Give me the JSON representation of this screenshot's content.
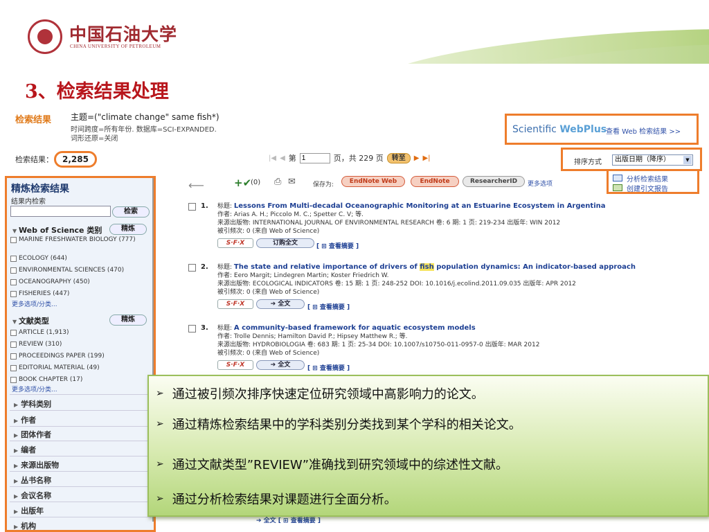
{
  "header": {
    "logo_cn": "中国石油大学",
    "logo_en": "CHINA UNIVERSITY OF PETROLEUM"
  },
  "slide_title": "3、检索结果处理",
  "search": {
    "result_heading": "检索结果",
    "query": "主题=(\"climate change\" same fish*)",
    "timespan": "时间跨度=所有年份. 数据库=SCI-EXPANDED.",
    "lemmatization": "词形还原=关闭",
    "count_label": "检索结果：",
    "count_value": "2,285"
  },
  "scientific_webplus": {
    "logo_a": "Scientific ",
    "logo_b": "WebPlus",
    "link": "查看 Web 检索结果 >>"
  },
  "pager": {
    "first": "|◀",
    "prev": "◀",
    "page_label": "第",
    "page_value": "1",
    "total": "页，共 229 页",
    "goto": "转至",
    "next": "▶",
    "last": "▶|"
  },
  "sort": {
    "label": "排序方式",
    "value": "出版日期（降序）"
  },
  "refine": {
    "title": "精炼检索结果",
    "within_label": "结果内检索",
    "search_btn": "检索",
    "wos_section": "Web of Science 类别",
    "refine_btn": "精炼",
    "wos_items": [
      "MARINE FRESHWATER BIOLOGY (777)",
      "ECOLOGY (644)",
      "ENVIRONMENTAL SCIENCES (470)",
      "OCEANOGRAPHY (450)",
      "FISHERIES (447)"
    ],
    "more": "更多选项/分类...",
    "doc_section": "文献类型",
    "doc_items": [
      "ARTICLE (1,913)",
      "REVIEW (310)",
      "PROCEEDINGS PAPER (199)",
      "EDITORIAL MATERIAL (49)",
      "BOOK CHAPTER (17)"
    ],
    "categories": [
      "学科类别",
      "作者",
      "团体作者",
      "编者",
      "来源出版物",
      "丛书名称",
      "会议名称",
      "出版年",
      "机构"
    ]
  },
  "toolbar": {
    "count": "(0)",
    "save_as": "保存为:",
    "endnote_web": "EndNote Web",
    "endnote": "EndNote",
    "researcherid": "ResearcherID",
    "more": "更多选项",
    "analyze": "分析检索结果",
    "citation_report": "创建引文报告"
  },
  "records": [
    {
      "num": "1.",
      "title_prefix": "标题: ",
      "title": "Lessons From Multi-decadal Oceanographic Monitoring at an Estuarine Ecosystem in Argentina",
      "authors": "作者: Arias A. H.; Piccolo M. C.; Spetter C. V; 等.",
      "source": "来源出版物: INTERNATIONAL JOURNAL OF ENVIRONMENTAL RESEARCH  卷: 6  期: 1  页: 219-234  出版年: WIN 2012",
      "cited": "被引频次: 0 (来自 Web of Science)",
      "fulltext": "订购全文",
      "abstract": "[ ⊞ 查看摘要 ]"
    },
    {
      "num": "2.",
      "title_prefix": "标题: ",
      "title_a": "The state and relative importance of drivers of ",
      "title_hl": "fish",
      "title_b": " population dynamics: An indicator-based approach",
      "authors": "作者: Eero Margit; Lindegren Martin; Koster Friedrich W.",
      "source": "来源出版物: ECOLOGICAL INDICATORS  卷: 15  期: 1  页: 248-252  DOI: 10.1016/j.ecolind.2011.09.035  出版年: APR 2012",
      "cited": "被引频次: 0 (来自 Web of Science)",
      "fulltext": "➔ 全文",
      "abstract": "[ ⊞ 查看摘要 ]"
    },
    {
      "num": "3.",
      "title_prefix": "标题: ",
      "title": "A community-based framework for aquatic ecosystem models",
      "authors": "作者: Trolle Dennis; Hamilton David P.; Hipsey Matthew R.; 等.",
      "source": "来源出版物: HYDROBIOLOGIA  卷: 683  期: 1  页: 25-34  DOI: 10.1007/s10750-011-0957-0  出版年: MAR 2012",
      "cited": "被引频次: 0 (来自 Web of Science)",
      "fulltext": "➔ 全文",
      "abstract": "[ ⊞ 查看摘要 ]"
    }
  ],
  "sfx_label": "S·F·X",
  "overlay": {
    "bullet": "➢",
    "lines": [
      "通过被引频次排序快速定位研究领域中高影响力的论文。",
      "通过精炼检索结果中的学科类别分类找到某个学科的相关论文。",
      "通过文献类型”REVIEW”准确找到研究领域中的综述性文献。",
      "通过分析检索结果对课题进行全面分析。"
    ]
  },
  "bottom_partial": "➔ 全文  [ ⊞ 查看摘要 ]",
  "colors": {
    "accent_orange": "#ee7d2c",
    "title_red": "#b8161c",
    "link_blue": "#1d3f93"
  }
}
